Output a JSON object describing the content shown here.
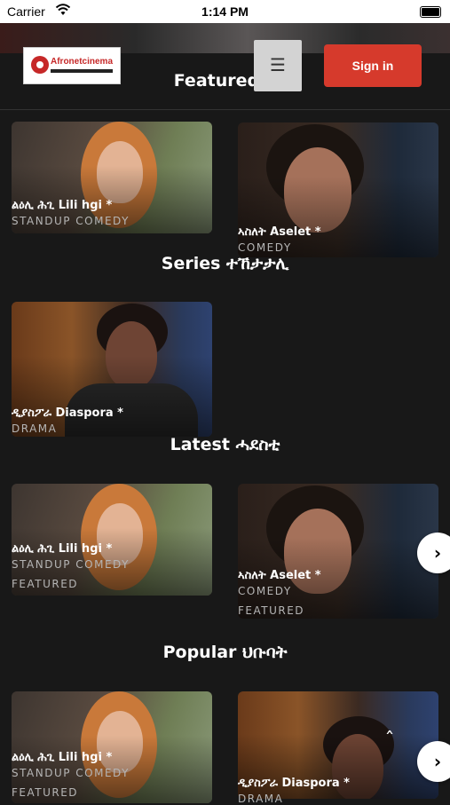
{
  "status_bar": {
    "carrier": "Carrier",
    "time": "1:14 PM"
  },
  "header": {
    "logo_text": "Afronetcinema",
    "menu_icon": "hamburger-icon",
    "signin_label": "Sign in"
  },
  "sections": {
    "featured": {
      "title": "Featured ፍ",
      "cards": [
        {
          "title": "ልዕሊ ሕጊ Lili hgi *",
          "genre": "STANDUP COMEDY"
        },
        {
          "title": "ኣስለት Aselet *",
          "genre": "COMEDY"
        }
      ]
    },
    "series": {
      "title": "Series ተኸታታሊ",
      "cards": [
        {
          "title": "ዲያስፖራ Diaspora *",
          "genre": "DRAMA"
        }
      ]
    },
    "latest": {
      "title": "Latest ሓደስቲ",
      "cards": [
        {
          "title": "ልዕሊ ሕጊ Lili hgi *",
          "genre": "STANDUP COMEDY",
          "tag": "FEATURED"
        },
        {
          "title": "ኣስለት Aselet *",
          "genre": "COMEDY",
          "tag": "FEATURED"
        }
      ]
    },
    "popular": {
      "title": "Popular ህቡባት",
      "cards": [
        {
          "title": "ልዕሊ ሕጊ Lili hgi *",
          "genre": "STANDUP COMEDY",
          "tag": "FEATURED"
        },
        {
          "title": "ዲያስፖራ Diaspora *",
          "genre": "DRAMA"
        }
      ]
    }
  },
  "controls": {
    "next_icon": "chevron-right-icon",
    "scroll_top_icon": "chevron-up-icon"
  },
  "colors": {
    "background": "#181818",
    "accent": "#d63a2c",
    "menu_button": "#d3d3d3"
  }
}
